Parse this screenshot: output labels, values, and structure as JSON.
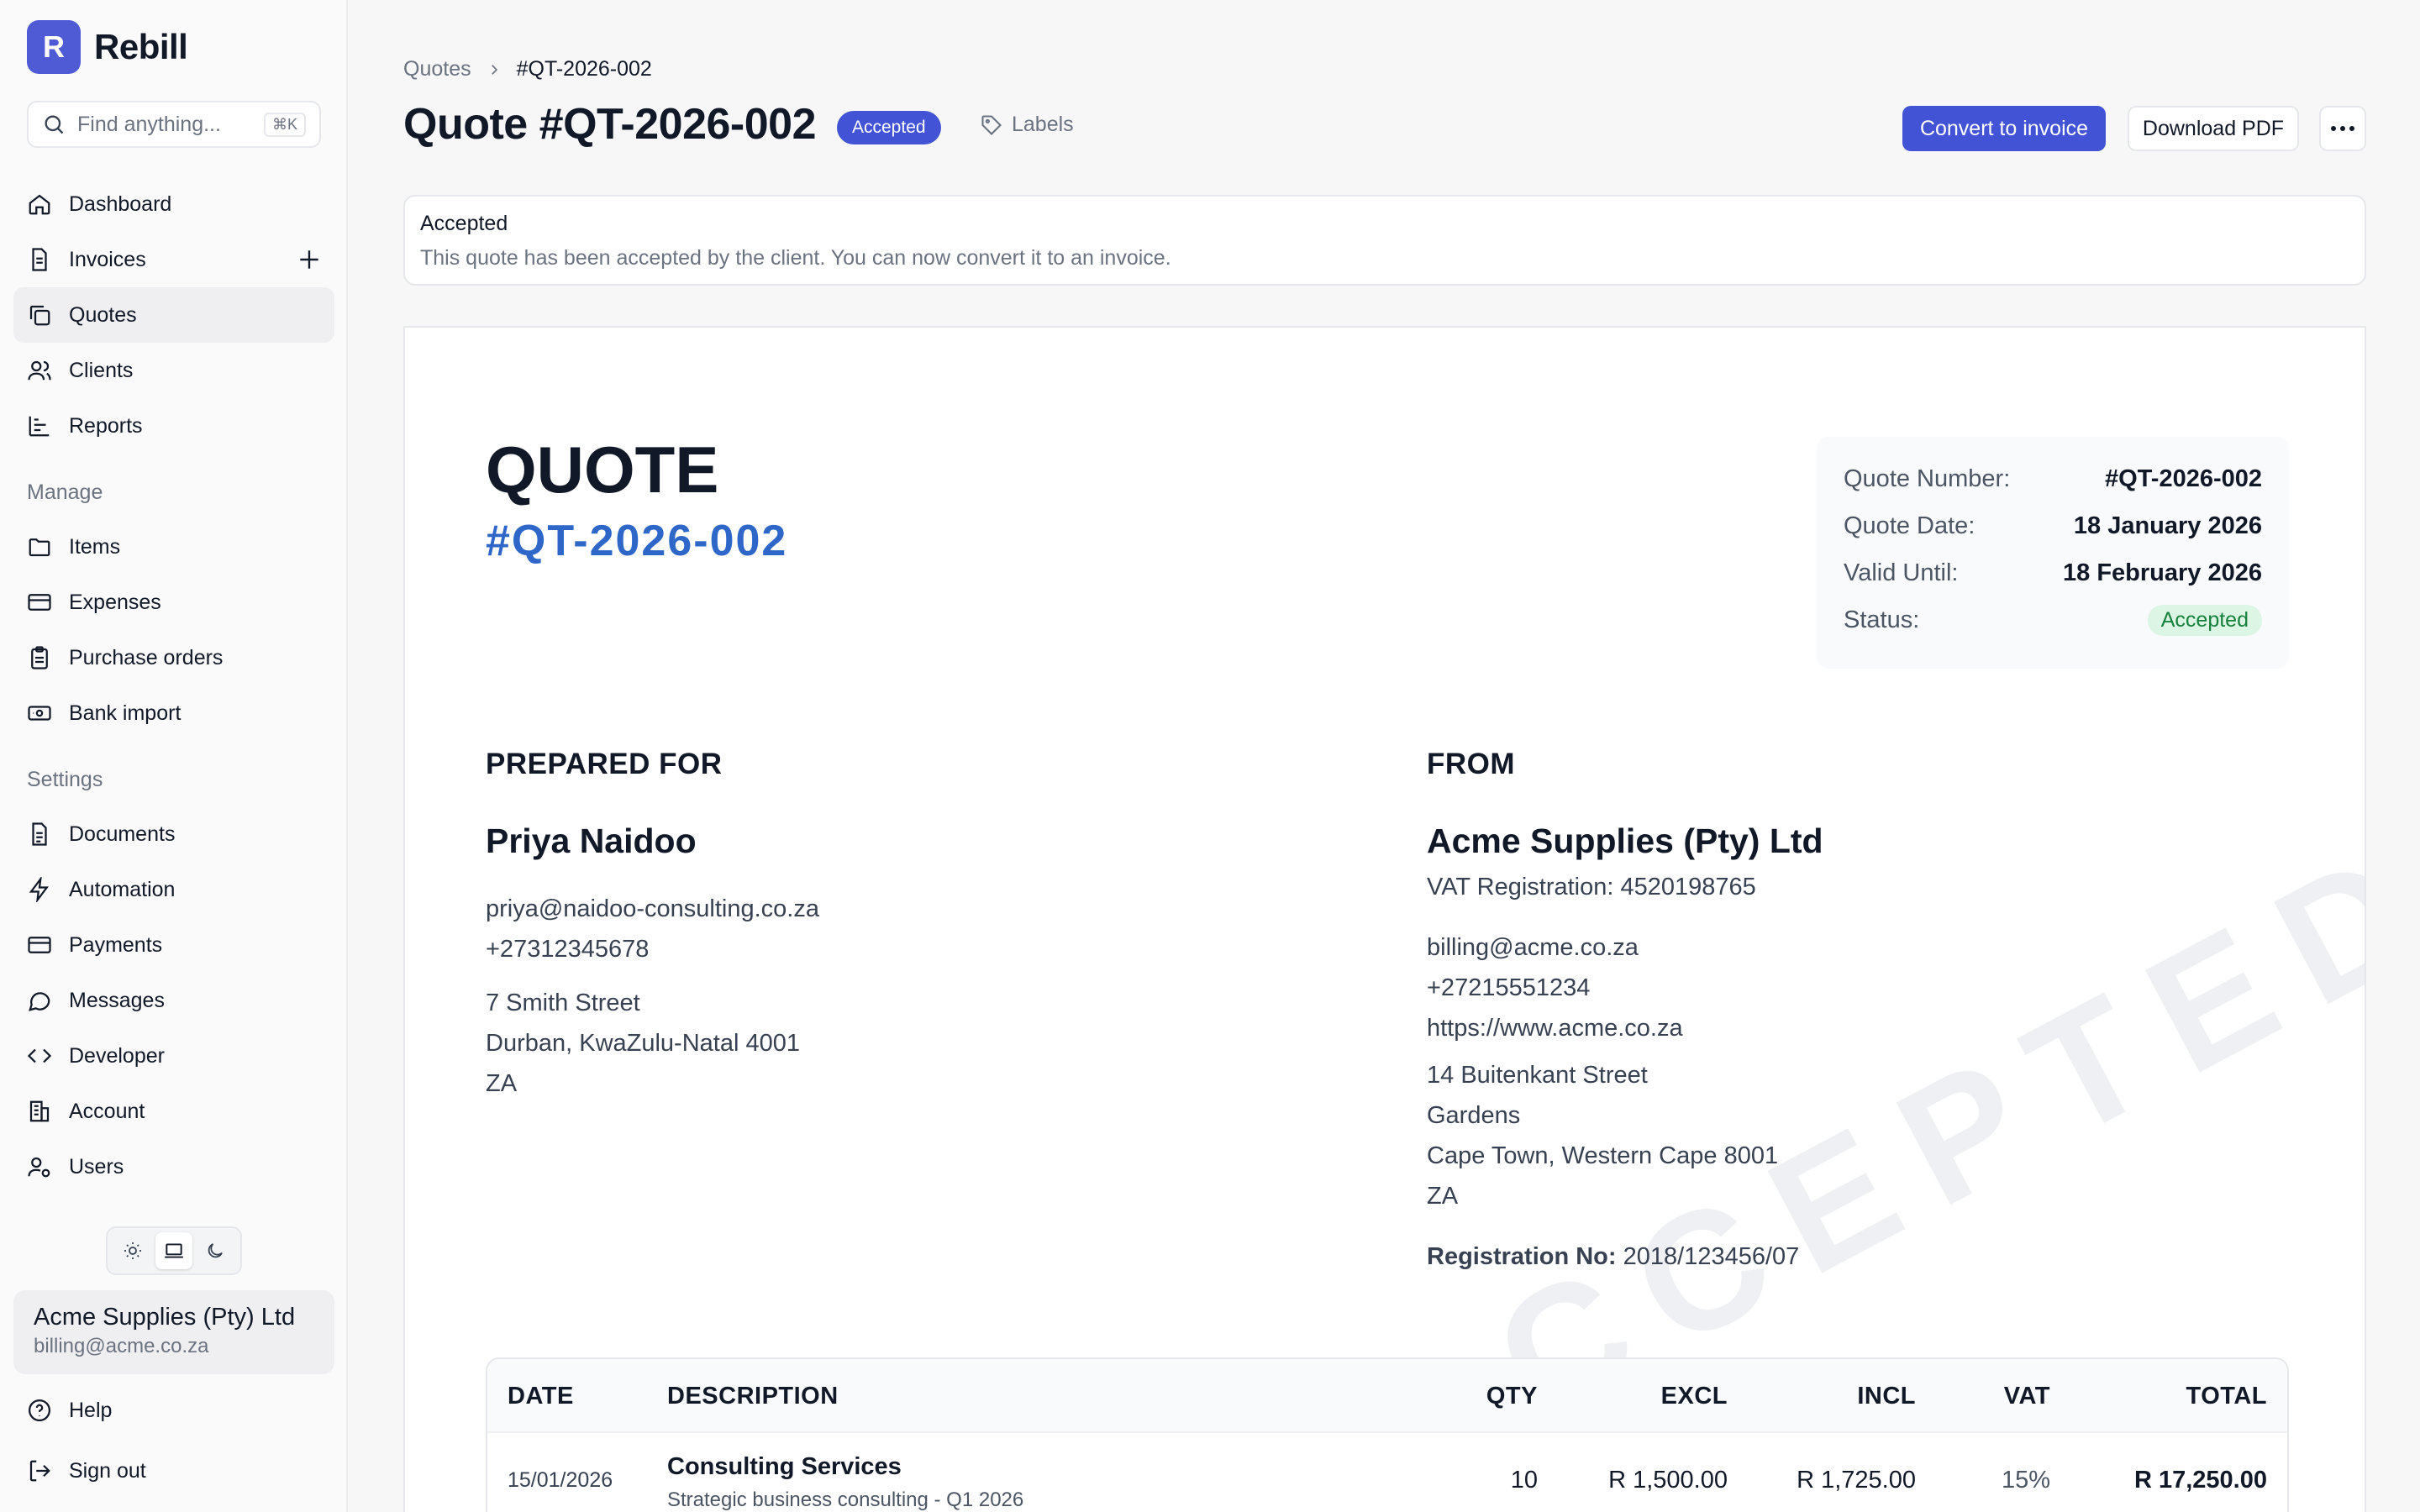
{
  "brand": {
    "logo_letter": "R",
    "name": "Rebill"
  },
  "search": {
    "placeholder": "Find anything...",
    "shortcut": "⌘K"
  },
  "nav": {
    "main": [
      "Dashboard",
      "Invoices",
      "Quotes",
      "Clients",
      "Reports"
    ],
    "manage_label": "Manage",
    "manage": [
      "Items",
      "Expenses",
      "Purchase orders",
      "Bank import"
    ],
    "settings_label": "Settings",
    "settings": [
      "Documents",
      "Automation",
      "Payments",
      "Messages",
      "Developer",
      "Account",
      "Users"
    ],
    "active": "Quotes"
  },
  "account": {
    "name": "Acme Supplies (Pty) Ltd",
    "email": "billing@acme.co.za"
  },
  "footer": {
    "help": "Help",
    "sign_out": "Sign out"
  },
  "breadcrumb": {
    "parent": "Quotes",
    "current": "#QT-2026-002"
  },
  "header": {
    "title": "Quote #QT-2026-002",
    "status": "Accepted",
    "labels": "Labels",
    "convert": "Convert to invoice",
    "download": "Download PDF"
  },
  "alert": {
    "title": "Accepted",
    "text": "This quote has been accepted by the client. You can now convert it to an invoice."
  },
  "document": {
    "heading": "QUOTE",
    "number": "#QT-2026-002",
    "watermark": "ACCEPTED",
    "meta": {
      "number_label": "Quote Number:",
      "number_value": "#QT-2026-002",
      "date_label": "Quote Date:",
      "date_value": "18 January 2026",
      "valid_label": "Valid Until:",
      "valid_value": "18 February 2026",
      "status_label": "Status:",
      "status_value": "Accepted"
    },
    "prepared_for": {
      "heading": "PREPARED FOR",
      "name": "Priya Naidoo",
      "email": "priya@naidoo-consulting.co.za",
      "phone": "+27312345678",
      "address1": "7 Smith Street",
      "address2": "Durban, KwaZulu-Natal 4001",
      "country": "ZA"
    },
    "from": {
      "heading": "FROM",
      "name": "Acme Supplies (Pty) Ltd",
      "vat": "VAT Registration: 4520198765",
      "email": "billing@acme.co.za",
      "phone": "+27215551234",
      "website": "https://www.acme.co.za",
      "address1": "14 Buitenkant Street",
      "address2": "Gardens",
      "address3": "Cape Town, Western Cape 8001",
      "country": "ZA",
      "reg_label": "Registration No:",
      "reg_value": "2018/123456/07"
    },
    "table": {
      "headers": [
        "DATE",
        "DESCRIPTION",
        "QTY",
        "EXCL",
        "INCL",
        "VAT",
        "TOTAL"
      ],
      "rows": [
        {
          "date": "15/01/2026",
          "description": "Consulting Services",
          "detail": "Strategic business consulting - Q1 2026",
          "qty": "10",
          "excl": "R 1,500.00",
          "incl": "R 1,725.00",
          "vat": "15%",
          "total": "R 17,250.00"
        }
      ]
    }
  },
  "colors": {
    "accent": "#4353d5",
    "link_blue": "#2f67c9",
    "success_bg": "#dcf5e5",
    "success_text": "#17803d"
  }
}
